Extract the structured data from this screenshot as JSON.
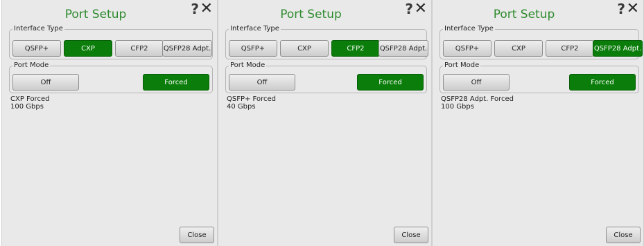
{
  "panels": [
    {
      "title": "Port Setup",
      "help_icon": "?",
      "close_icon": "✕",
      "interface_legend": "Interface Type",
      "interface_buttons": [
        "QSFP+",
        "CXP",
        "CFP2",
        "QSFP28 Adpt."
      ],
      "interface_selected": "CXP",
      "mode_legend": "Port Mode",
      "mode_buttons": [
        "Off",
        "Forced"
      ],
      "mode_selected": "Forced",
      "status_line1": "CXP Forced",
      "status_line2": "100 Gbps",
      "close_label": "Close"
    },
    {
      "title": "Port Setup",
      "help_icon": "?",
      "close_icon": "✕",
      "interface_legend": "Interface Type",
      "interface_buttons": [
        "QSFP+",
        "CXP",
        "CFP2",
        "QSFP28 Adpt."
      ],
      "interface_selected": "CFP2",
      "mode_legend": "Port Mode",
      "mode_buttons": [
        "Off",
        "Forced"
      ],
      "mode_selected": "Forced",
      "status_line1": "QSFP+ Forced",
      "status_line2": "40 Gbps",
      "close_label": "Close"
    },
    {
      "title": "Port Setup",
      "help_icon": "?",
      "close_icon": "✕",
      "interface_legend": "Interface Type",
      "interface_buttons": [
        "QSFP+",
        "CXP",
        "CFP2",
        "QSFP28 Adpt."
      ],
      "interface_selected": "QSFP28 Adpt.",
      "mode_legend": "Port Mode",
      "mode_buttons": [
        "Off",
        "Forced"
      ],
      "mode_selected": "Forced",
      "status_line1": "QSFP28 Adpt. Forced",
      "status_line2": "100 Gbps",
      "close_label": "Close"
    }
  ],
  "colors": {
    "title": "#2e8b2e",
    "selected_button": "#0a7d0a",
    "panel_background": "#e9e9e9"
  }
}
